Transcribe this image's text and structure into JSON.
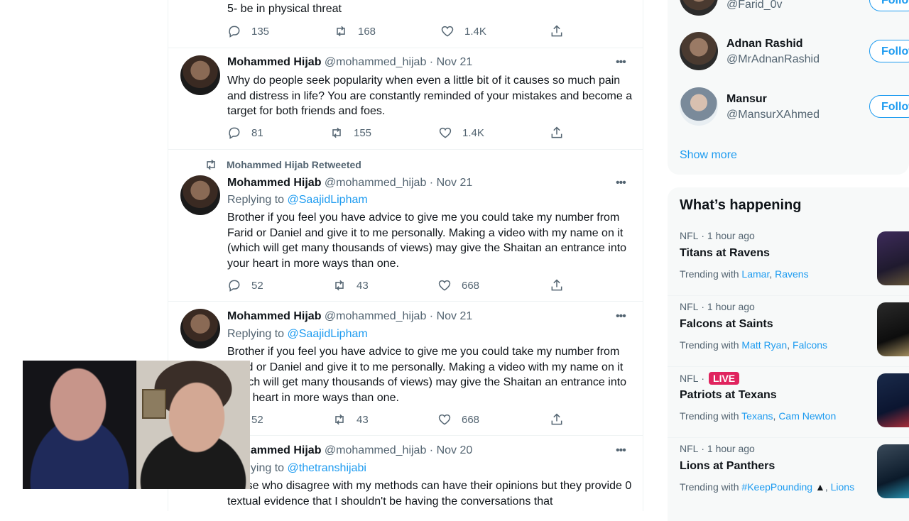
{
  "tweets": {
    "t0": {
      "text": "5- be in physical threat",
      "replies": "135",
      "retweets": "168",
      "likes": "1.4K"
    },
    "t1": {
      "name": "Mohammed Hijab",
      "handle": "@mohammed_hijab",
      "date": "· Nov 21",
      "text": "Why do people seek popularity when even a little bit of  it causes so much pain and distress in life? You are constantly reminded of your mistakes and become a target for both friends and foes.",
      "replies": "81",
      "retweets": "155",
      "likes": "1.4K"
    },
    "t2": {
      "retweeted_label": "Mohammed Hijab Retweeted",
      "name": "Mohammed Hijab",
      "handle": "@mohammed_hijab",
      "date": "· Nov 21",
      "replying_prefix": "Replying to ",
      "replying_to": "@SaajidLipham",
      "text": "Brother if you feel you have advice to give me you could take my number from Farid or Daniel and give it to me personally. Making a video with my name on it (which will get many thousands of views) may give the Shaitan an entrance into your heart in more ways than one.",
      "replies": "52",
      "retweets": "43",
      "likes": "668"
    },
    "t3": {
      "name": "Mohammed Hijab",
      "handle": "@mohammed_hijab",
      "date": "· Nov 21",
      "replying_prefix": "Replying to ",
      "replying_to": "@SaajidLipham",
      "text": "Brother if you feel you have advice to give me you could take my number from Farid or Daniel and give it to me personally. Making a video with my name on it (which will get many thousands of views) may give the Shaitan an entrance into your heart in more ways than one.",
      "replies": "52",
      "retweets": "43",
      "likes": "668"
    },
    "t4": {
      "name": "Mohammed Hijab",
      "handle": "@mohammed_hijab",
      "date": "· Nov 20",
      "replying_prefix": "Replying to ",
      "replying_to": "@thetranshijabi",
      "text": "Those who disagree with my methods can have their opinions but they provide 0 textual evidence that I shouldn't be having the conversations that"
    }
  },
  "who_to_follow": {
    "top_handle": "@Farid_0v",
    "users": [
      {
        "name": "Adnan Rashid",
        "handle": "@MrAdnanRashid",
        "button": "Follow"
      },
      {
        "name": "Mansur",
        "handle": "@MansurXAhmed",
        "button": "Follow"
      }
    ],
    "show_more": "Show more"
  },
  "happening": {
    "title": "What’s happening",
    "trends": [
      {
        "category": "NFL",
        "time": "· 1 hour ago",
        "live": "",
        "title": "Titans at Ravens",
        "with_label": "Trending with ",
        "links": [
          "Lamar",
          "Ravens"
        ]
      },
      {
        "category": "NFL",
        "time": "· 1 hour ago",
        "live": "",
        "title": "Falcons at Saints",
        "with_label": "Trending with ",
        "links": [
          "Matt Ryan",
          "Falcons"
        ]
      },
      {
        "category": "NFL",
        "time": "·",
        "live": "LIVE",
        "title": "Patriots at Texans",
        "with_label": "Trending with ",
        "links": [
          "Texans",
          "Cam Newton"
        ]
      },
      {
        "category": "NFL",
        "time": "· 1 hour ago",
        "live": "",
        "title": "Lions at Panthers",
        "with_label": "Trending with ",
        "links": [
          "#KeepPounding",
          "Lions"
        ]
      }
    ]
  },
  "colors": {
    "accent": "#1d9bf0",
    "muted": "#536471",
    "live": "#e0245e"
  },
  "icons": [
    "reply-icon",
    "retweet-icon",
    "like-icon",
    "share-icon",
    "more-icon",
    "panther-icon"
  ]
}
